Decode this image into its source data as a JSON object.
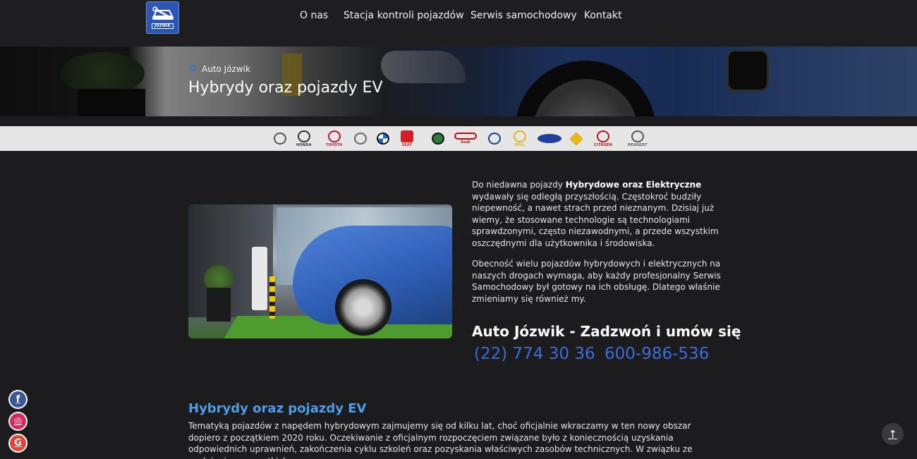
{
  "header": {
    "logo_text": "JÓZWIK",
    "nav": [
      {
        "label": "O nas"
      },
      {
        "label": "Stacja kontroli pojazdów"
      },
      {
        "label": "Serwis samochodowy"
      },
      {
        "label": "Kontakt"
      }
    ]
  },
  "hero": {
    "breadcrumb": "Auto Józwik",
    "title": "Hybrydy oraz pojazdy EV"
  },
  "brands": [
    {
      "name": "MAZDA",
      "label": "",
      "color": "#555555"
    },
    {
      "name": "HONDA",
      "label": "HONDA",
      "color": "#333333"
    },
    {
      "name": "TOYOTA",
      "label": "TOYOTA",
      "color": "#c8102e"
    },
    {
      "name": "MERCEDES",
      "label": "",
      "color": "#666666"
    },
    {
      "name": "BMW",
      "label": "",
      "color": "#1c69d4"
    },
    {
      "name": "SEAT",
      "label": "SEAT",
      "color": "#d41f26"
    },
    {
      "name": "SKODA",
      "label": "",
      "color": "#2a7a3a"
    },
    {
      "name": "AUDI",
      "label": "Audi",
      "color": "#bb0a14"
    },
    {
      "name": "VOLKSWAGEN",
      "label": "",
      "color": "#1b3f8f"
    },
    {
      "name": "OPEL",
      "label": "OPEL",
      "color": "#e3b21c"
    },
    {
      "name": "FORD",
      "label": "",
      "color": "#1f3f99"
    },
    {
      "name": "RENAULT",
      "label": "",
      "color": "#e9b51c"
    },
    {
      "name": "CITROEN",
      "label": "CITROËN",
      "color": "#b11a1a"
    },
    {
      "name": "PEUGEOT",
      "label": "PEUGEOT",
      "color": "#555555"
    }
  ],
  "intro": {
    "p1_pre": "Do niedawna pojazdy ",
    "p1_bold": "Hybrydowe oraz Elektryczne",
    "p1_post": " wydawały się odległą przyszłością. Częstokroć budziły niepewność, a nawet strach przed nieznanym. Dzisiaj już wiemy, że stosowane technologie są technologiami sprawdzonymi, często niezawodnymi, a przede wszystkim oszczędnymi dla użytkownika i środowiska.",
    "p2": "Obecność wielu pojazdów hybrydowych i elektrycznych na naszych drogach wymaga, aby każdy profesjonalny Serwis Samochodowy był gotowy na ich obsługę. Dlatego właśnie zmieniamy się również my."
  },
  "cta": {
    "title": "Auto Józwik - Zadzwoń i umów się",
    "phone1": "(22) 774 30 36",
    "phone2": "600-986-536"
  },
  "section": {
    "title": "Hybrydy oraz pojazdy EV",
    "text": "Tematyką pojazdów z napędem hybrydowym zajmujemy się od kilku lat, choć oficjalnie wkraczamy w ten nowy obszar dopiero z początkiem 2020 roku. Oczekiwanie z oficjalnym rozpoczęciem związane było z koniecznością uzyskania odpowiednich uprawnień, zakończenia cyklu szkoleń oraz pozyskania właściwych zasobów technicznych.  W związku ze spełnieniem wszystkich"
  },
  "social": [
    {
      "name": "facebook",
      "glyph": "f",
      "color": "#3b5998"
    },
    {
      "name": "instagram",
      "glyph": "◎",
      "color": "#d6295d"
    },
    {
      "name": "google",
      "glyph": "G",
      "color": "#e0453a"
    }
  ],
  "to_top_glyph": "↑"
}
